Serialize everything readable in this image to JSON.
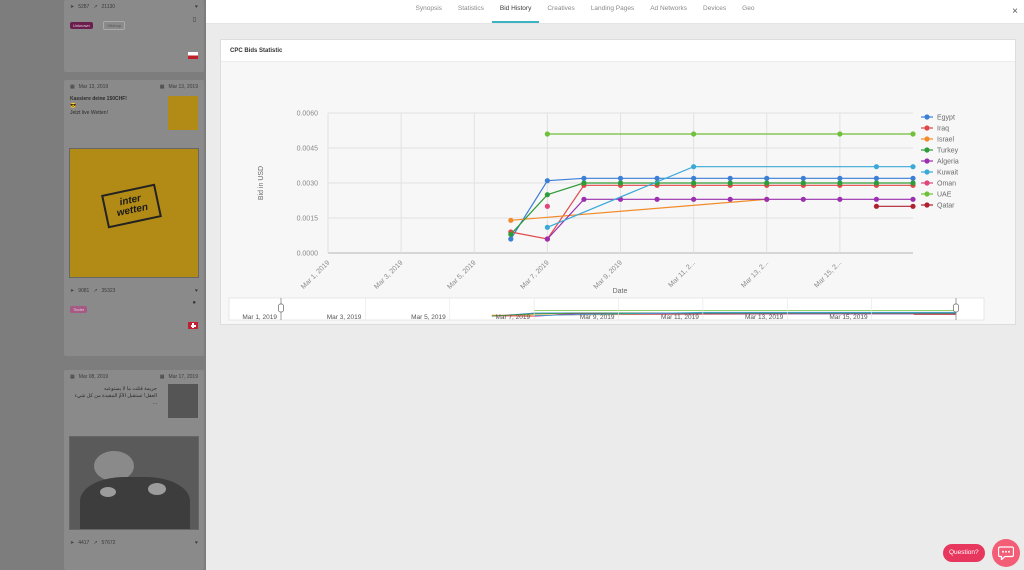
{
  "feed": {
    "card1": {
      "share_count": "5287",
      "trend_count": "21130",
      "tags": [
        "Unknown",
        "Offshop"
      ]
    },
    "card2": {
      "first_seen": "Mar 13, 2019",
      "last_seen": "Mar 13, 2019",
      "title": "Kassiere deine 150CHF!",
      "emoji": "😎",
      "subtitle": "Jetzt live Wetten!",
      "logo_line1": "inter",
      "logo_line2": "wetten",
      "share_count": "9081",
      "trend_count": "35323",
      "tags": [
        "Tinder"
      ]
    },
    "card3": {
      "first_seen": "Mar 08, 2019",
      "last_seen": "Mar 17, 2019",
      "title_ar": "جريمة قتلت ما لا يستوعبه",
      "subtitle_ar": "العقل! تستقبل الأمّ المقيدة من كل شيء ...",
      "share_count": "4417",
      "trend_count": "57672"
    }
  },
  "tabs": [
    {
      "label": "Synopsis",
      "active": false
    },
    {
      "label": "Statistics",
      "active": false
    },
    {
      "label": "Bid History",
      "active": true
    },
    {
      "label": "Creatives",
      "active": false
    },
    {
      "label": "Landing Pages",
      "active": false
    },
    {
      "label": "Ad Networks",
      "active": false
    },
    {
      "label": "Devices",
      "active": false
    },
    {
      "label": "Geo",
      "active": false
    }
  ],
  "close_label": "×",
  "panel": {
    "title": "CPC Bids Statistic"
  },
  "chart_data": {
    "type": "line",
    "title": "",
    "xlabel": "Date",
    "ylabel": "Bid in USD",
    "x_ticks": [
      "Mar 1, 2019",
      "Mar 3, 2019",
      "Mar 5, 2019",
      "Mar 7, 2019",
      "Mar 9, 2019",
      "Mar 11, 2...",
      "Mar 13, 2...",
      "Mar 15, 2..."
    ],
    "y_ticks": [
      "0.0060",
      "0.0045",
      "0.0030",
      "0.0015",
      "0.0000"
    ],
    "ylim": [
      0,
      0.006
    ],
    "xlim_days": [
      1,
      17
    ],
    "grid": true,
    "legend_position": "right",
    "range_ticks": [
      "Mar 1, 2019",
      "Mar 3, 2019",
      "Mar 5, 2019",
      "Mar 7, 2019",
      "Mar 9, 2019",
      "Mar 11, 2019",
      "Mar 13, 2019",
      "Mar 15, 2019"
    ],
    "series": [
      {
        "name": "Egypt",
        "color": "#3b7fd6",
        "points": [
          [
            6.0,
            0.0006
          ],
          [
            7.0,
            0.0031
          ],
          [
            8.0,
            0.0032
          ],
          [
            9.0,
            0.0032
          ],
          [
            10.0,
            0.0032
          ],
          [
            11.0,
            0.0032
          ],
          [
            12.0,
            0.0032
          ],
          [
            13.0,
            0.0032
          ],
          [
            14.0,
            0.0032
          ],
          [
            15.0,
            0.0032
          ],
          [
            16.0,
            0.0032
          ],
          [
            17.0,
            0.0032
          ]
        ]
      },
      {
        "name": "Iraq",
        "color": "#e04848",
        "points": [
          [
            6.0,
            0.0009
          ],
          [
            7.0,
            0.0006
          ],
          [
            8.0,
            0.0029
          ],
          [
            9.0,
            0.0029
          ],
          [
            10.0,
            0.0029
          ],
          [
            11.0,
            0.0029
          ],
          [
            12.0,
            0.0029
          ],
          [
            13.0,
            0.0029
          ],
          [
            14.0,
            0.0029
          ],
          [
            15.0,
            0.0029
          ],
          [
            16.0,
            0.0029
          ],
          [
            17.0,
            0.0029
          ]
        ]
      },
      {
        "name": "Israel",
        "color": "#f28c2a",
        "points": [
          [
            6.0,
            0.0014
          ],
          [
            13.0,
            0.0023
          ]
        ]
      },
      {
        "name": "Turkey",
        "color": "#2f9c3a",
        "points": [
          [
            6.0,
            0.0008
          ],
          [
            7.0,
            0.0025
          ],
          [
            8.0,
            0.003
          ],
          [
            9.0,
            0.003
          ],
          [
            10.0,
            0.003
          ],
          [
            11.0,
            0.003
          ],
          [
            12.0,
            0.003
          ],
          [
            13.0,
            0.003
          ],
          [
            14.0,
            0.003
          ],
          [
            15.0,
            0.003
          ],
          [
            16.0,
            0.003
          ],
          [
            17.0,
            0.003
          ]
        ]
      },
      {
        "name": "Algeria",
        "color": "#9b2fae",
        "points": [
          [
            7.0,
            0.0006
          ],
          [
            8.0,
            0.0023
          ],
          [
            9.0,
            0.0023
          ],
          [
            10.0,
            0.0023
          ],
          [
            11.0,
            0.0023
          ],
          [
            12.0,
            0.0023
          ],
          [
            13.0,
            0.0023
          ],
          [
            14.0,
            0.0023
          ],
          [
            15.0,
            0.0023
          ],
          [
            16.0,
            0.0023
          ],
          [
            17.0,
            0.0023
          ]
        ]
      },
      {
        "name": "Kuwait",
        "color": "#3aa9d8",
        "points": [
          [
            7.0,
            0.0011
          ],
          [
            11.0,
            0.0037
          ],
          [
            16.0,
            0.0037
          ],
          [
            17.0,
            0.0037
          ]
        ]
      },
      {
        "name": "Oman",
        "color": "#e0457b",
        "points": [
          [
            7.0,
            0.002
          ]
        ]
      },
      {
        "name": "UAE",
        "color": "#6fc03a",
        "points": [
          [
            7.0,
            0.0051
          ],
          [
            11.0,
            0.0051
          ],
          [
            15.0,
            0.0051
          ],
          [
            17.0,
            0.0051
          ]
        ]
      },
      {
        "name": "Qatar",
        "color": "#b02030",
        "points": [
          [
            16.0,
            0.002
          ],
          [
            17.0,
            0.002
          ]
        ]
      }
    ]
  },
  "help": {
    "question_label": "Question?",
    "chat_icon": "chat-bubble-icon"
  }
}
